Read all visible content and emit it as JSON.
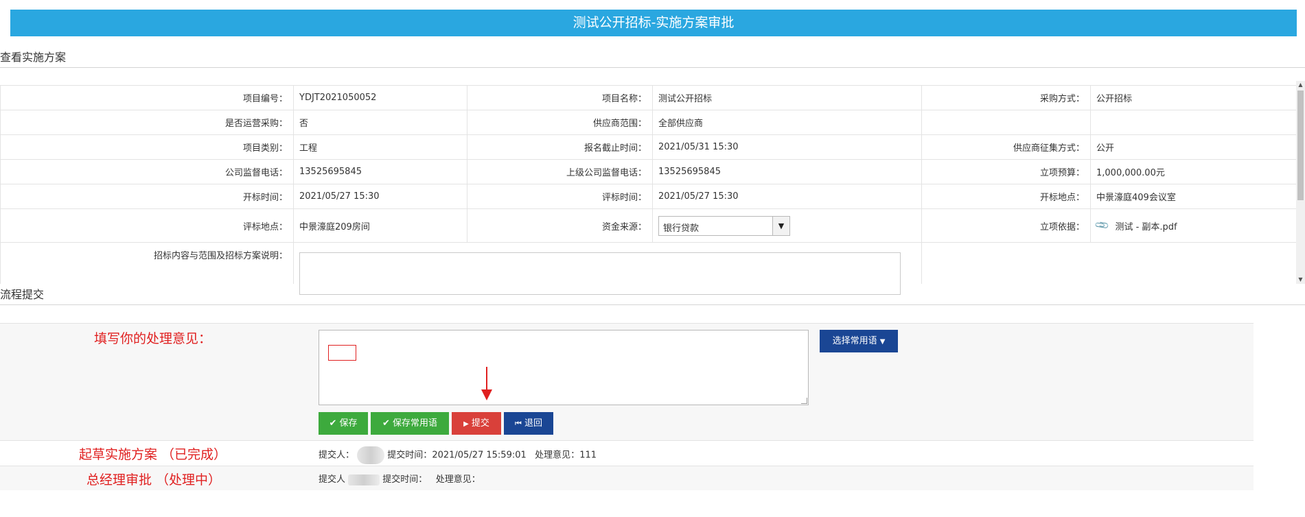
{
  "page_title": "测试公开招标-实施方案审批",
  "section_view": "查看实施方案",
  "section_flow": "流程提交",
  "info": {
    "rows": [
      [
        {
          "label": "项目编号：",
          "value": "YDJT2021050052"
        },
        {
          "label": "项目名称：",
          "value": "测试公开招标"
        },
        {
          "label": "采购方式：",
          "value": "公开招标"
        }
      ],
      [
        {
          "label": "是否运营采购：",
          "value": "否"
        },
        {
          "label": "供应商范围：",
          "value": "全部供应商"
        },
        {
          "label": "",
          "value": ""
        }
      ],
      [
        {
          "label": "项目类别：",
          "value": "工程"
        },
        {
          "label": "报名截止时间：",
          "value": "2021/05/31 15:30"
        },
        {
          "label": "供应商征集方式：",
          "value": "公开"
        }
      ],
      [
        {
          "label": "公司监督电话：",
          "value": "13525695845"
        },
        {
          "label": "上级公司监督电话：",
          "value": "13525695845"
        },
        {
          "label": "立项预算：",
          "value": "1,000,000.00元"
        }
      ],
      [
        {
          "label": "开标时间：",
          "value": "2021/05/27 15:30"
        },
        {
          "label": "评标时间：",
          "value": "2021/05/27 15:30"
        },
        {
          "label": "开标地点：",
          "value": "中景濠庭409会议室"
        }
      ]
    ],
    "row6": {
      "eval_place_label": "评标地点：",
      "eval_place_value": "中景濠庭209房间",
      "fund_label": "资金来源：",
      "fund_selected": "银行贷款",
      "basis_label": "立项依据：",
      "basis_file": "测试 - 副本.pdf"
    },
    "row7": {
      "desc_label": "招标内容与范围及招标方案说明："
    }
  },
  "flow": {
    "opinion_label": "填写你的处理意见：",
    "common_phrase_button": "选择常用语",
    "buttons": {
      "save": "保存",
      "save_phrase": "保存常用语",
      "submit": "提交",
      "back": "退回"
    },
    "history": [
      {
        "step": "起草实施方案 （已完成）",
        "submitter_label": "提交人：",
        "time_label": "提交时间：",
        "time_value": "2021/05/27 15:59:01",
        "opinion_label": "处理意见：",
        "opinion_value": "111"
      },
      {
        "step": "总经理审批 （处理中）",
        "submitter_label": "提交人",
        "time_label": "提交时间：",
        "time_value": "",
        "opinion_label": "处理意见：",
        "opinion_value": ""
      }
    ]
  },
  "colors": {
    "header": "#2aa7e0",
    "green": "#3daa3d",
    "red": "#d9403a",
    "blue": "#1a4694",
    "annotation": "#e02020"
  },
  "icons": [
    "check-icon",
    "play-icon",
    "skip-back-icon",
    "chevron-down-icon",
    "paperclip-icon"
  ]
}
